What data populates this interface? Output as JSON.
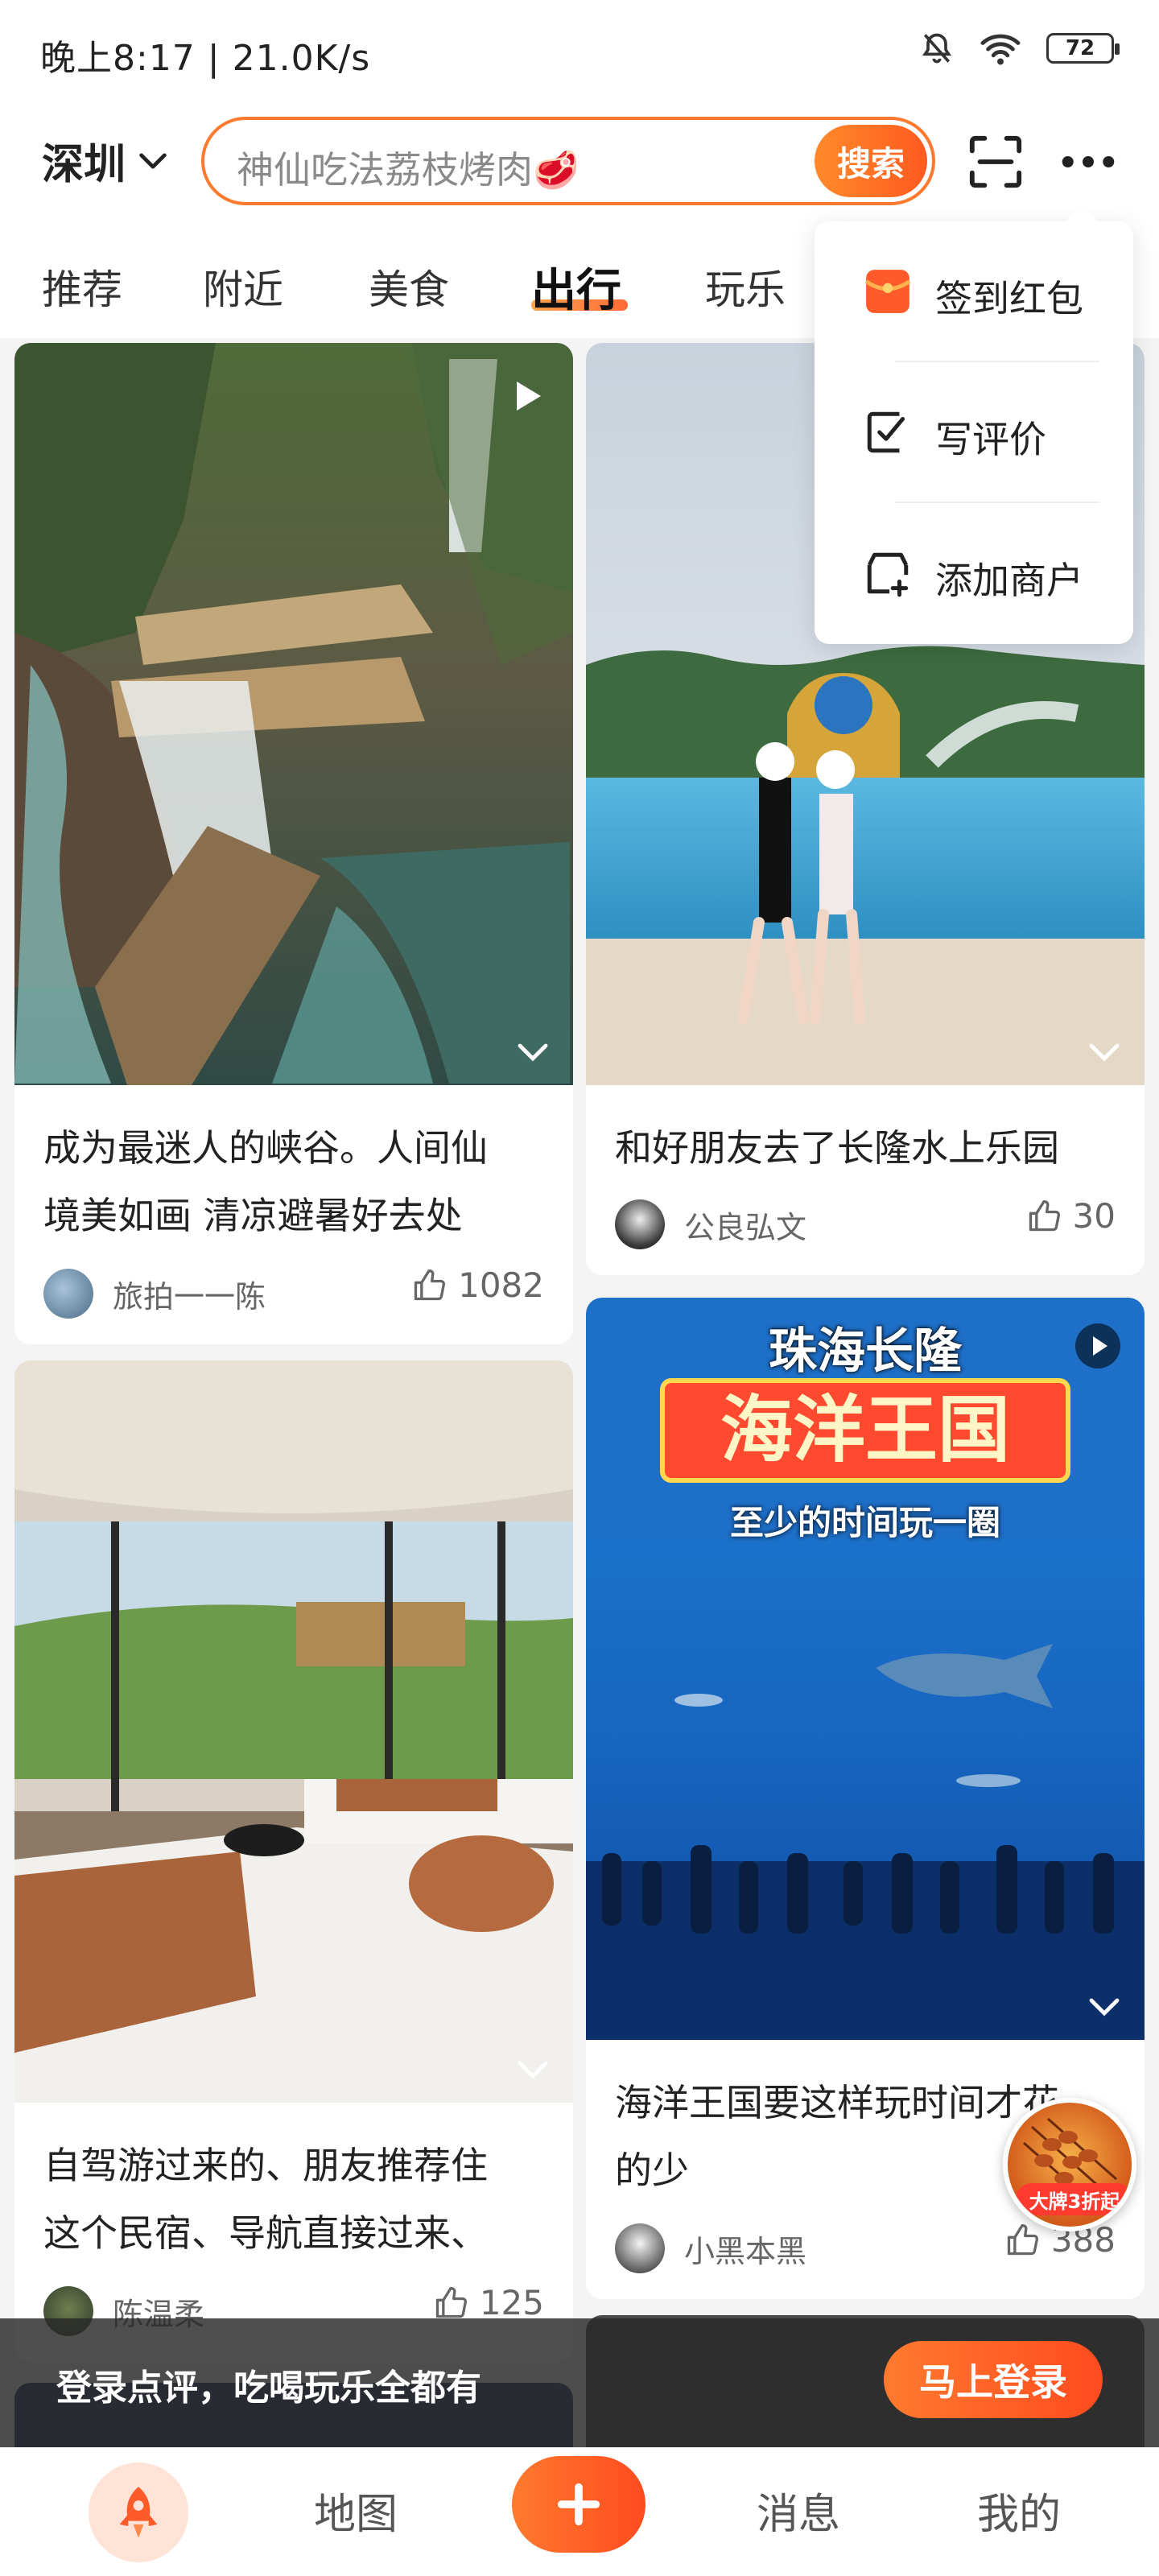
{
  "status_bar": {
    "text": "晚上8:17 | 21.0K/s",
    "battery": "72"
  },
  "header": {
    "city": "深圳",
    "search_placeholder": "神仙吃法荔枝烤肉🥩",
    "search_button": "搜索"
  },
  "tabs": [
    {
      "label": "推荐"
    },
    {
      "label": "附近"
    },
    {
      "label": "美食"
    },
    {
      "label": "出行",
      "active": true
    },
    {
      "label": "玩乐"
    }
  ],
  "popup_menu": [
    {
      "label": "签到红包",
      "icon": "red-envelope-icon"
    },
    {
      "label": "写评价",
      "icon": "write-review-icon"
    },
    {
      "label": "添加商户",
      "icon": "add-merchant-icon"
    }
  ],
  "cards": [
    {
      "title_line1": "成为最迷人的峡谷。人间仙",
      "title_line2": "境美如画 清凉避暑好去处",
      "author": "旅拍一一陈",
      "likes": "1082",
      "has_video": true
    },
    {
      "title_line1": "和好朋友去了长隆水上乐园",
      "author": "公良弘文",
      "likes": "30"
    },
    {
      "title_line1": "自驾游过来的、朋友推荐住",
      "title_line2": "这个民宿、导航直接过来、",
      "author": "陈温柔",
      "likes": "125"
    },
    {
      "title_line1": "海洋王国要这样玩时间才花",
      "title_line2": "的少",
      "author": "小黑本黑",
      "likes": "388",
      "has_video": true,
      "overlay_top": "珠海长隆",
      "overlay_main": "海洋王国",
      "overlay_sub": "至少的时间玩一圈"
    }
  ],
  "ad_float": {
    "label": "大牌3折起"
  },
  "login_banner": {
    "text": "登录点评，吃喝玩乐全都有",
    "button": "马上登录"
  },
  "bottom_nav": [
    {
      "label": ""
    },
    {
      "label": "地图"
    },
    {
      "label": ""
    },
    {
      "label": "消息"
    },
    {
      "label": "我的"
    }
  ],
  "colors": {
    "accent": "#ff6a23",
    "text": "#222222",
    "muted": "#666666"
  }
}
